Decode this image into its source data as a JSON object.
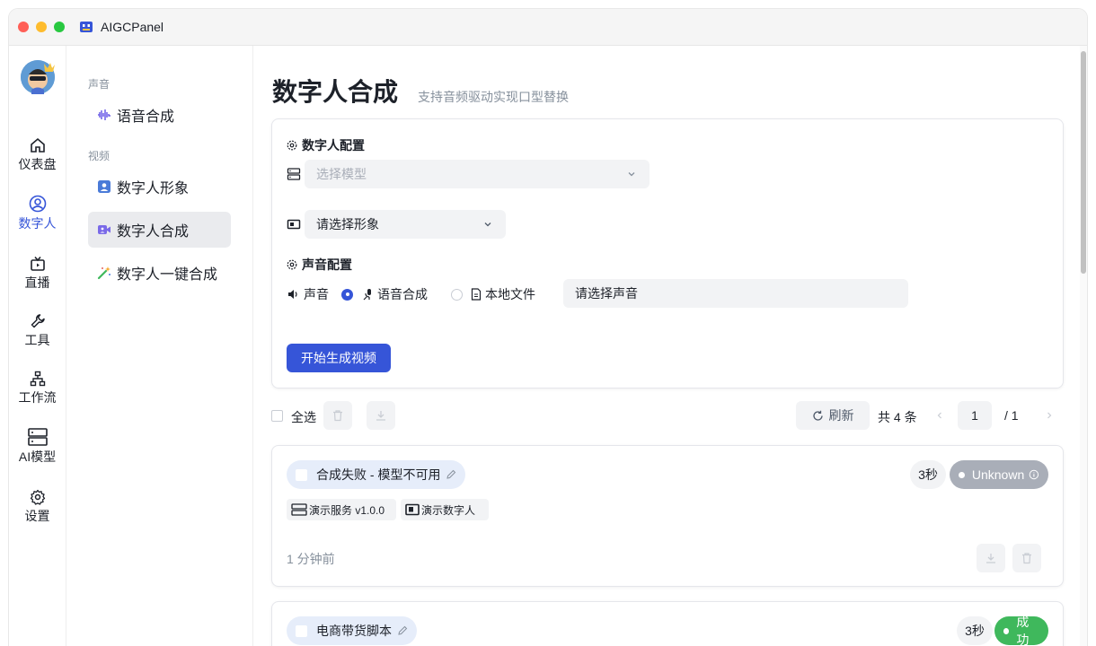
{
  "window": {
    "title": "AIGCPanel"
  },
  "nav": {
    "items": [
      {
        "label": "仪表盘",
        "icon": "home-icon"
      },
      {
        "label": "数字人",
        "icon": "user-circle-icon",
        "active": true
      },
      {
        "label": "直播",
        "icon": "tv-icon"
      },
      {
        "label": "工具",
        "icon": "wrench-icon"
      },
      {
        "label": "工作流",
        "icon": "workflow-icon"
      },
      {
        "label": "AI模型",
        "icon": "server-icon"
      },
      {
        "label": "设置",
        "icon": "gear-icon"
      }
    ]
  },
  "subnav": {
    "groups": [
      {
        "title": "声音",
        "items": [
          {
            "label": "语音合成",
            "icon": "waveform-icon"
          }
        ]
      },
      {
        "title": "视频",
        "items": [
          {
            "label": "数字人形象",
            "icon": "portrait-icon"
          },
          {
            "label": "数字人合成",
            "icon": "video-camera-icon",
            "active": true
          },
          {
            "label": "数字人一键合成",
            "icon": "magic-wand-icon"
          }
        ]
      }
    ]
  },
  "page": {
    "title": "数字人合成",
    "subtitle": "支持音频驱动实现口型替换"
  },
  "config": {
    "section_avatar": "数字人配置",
    "model_placeholder": "选择模型",
    "avatar_select": "请选择形象",
    "section_voice": "声音配置",
    "voice_label": "声音",
    "option_tts": "语音合成",
    "option_file": "本地文件",
    "voice_select": "请选择声音",
    "submit": "开始生成视频"
  },
  "toolbar": {
    "select_all": "全选",
    "refresh": "刷新",
    "total": "共 4 条",
    "page_current": "1",
    "page_total": "/ 1"
  },
  "tasks": [
    {
      "title": "合成失败 - 模型不可用",
      "duration": "3秒",
      "status": "Unknown",
      "status_color": "#a9aeb8",
      "tag_server": "演示服务 v1.0.0",
      "tag_avatar": "演示数字人",
      "time": "1 分钟前"
    },
    {
      "title": "电商带货脚本",
      "duration": "3秒",
      "status": "成功",
      "status_color": "#3fb85c"
    }
  ],
  "colors": {
    "accent": "#3655d8",
    "success": "#3fb85c",
    "unknown": "#a9aeb8"
  }
}
